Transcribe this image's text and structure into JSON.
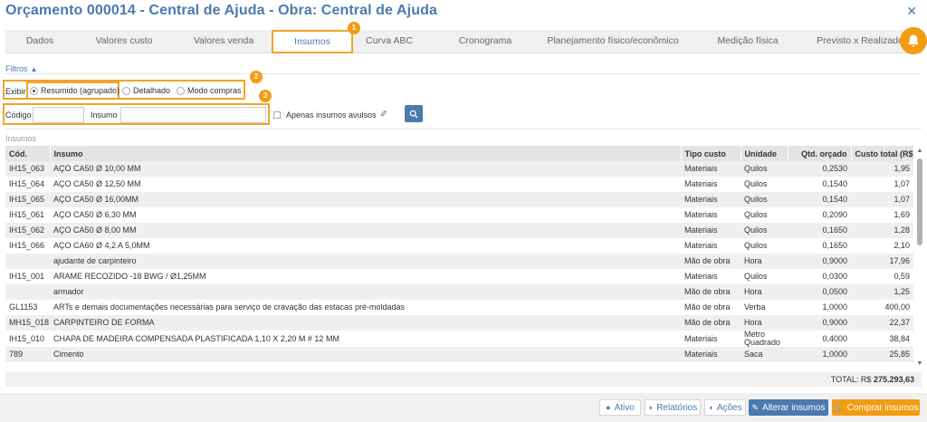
{
  "header": {
    "title": "Orçamento 000014 - Central de Ajuda - Obra: Central de Ajuda"
  },
  "tabs": [
    {
      "label": "Dados",
      "active": false
    },
    {
      "label": "Valores custo",
      "active": false
    },
    {
      "label": "Valores venda",
      "active": false
    },
    {
      "label": "Insumos",
      "active": true
    },
    {
      "label": "Curva ABC",
      "active": false
    },
    {
      "label": "Cronograma",
      "active": false
    },
    {
      "label": "Planejamento físico/econômico",
      "active": false
    },
    {
      "label": "Medição física",
      "active": false
    },
    {
      "label": "Previsto x Realizado",
      "active": false
    }
  ],
  "badges": [
    "1",
    "2",
    "3"
  ],
  "filters": {
    "toggle_label": "Filtros",
    "exibir_label": "Exibir",
    "options": [
      {
        "label": "Resumido (agrupado)",
        "selected": true
      },
      {
        "label": "Detalhado",
        "selected": false
      },
      {
        "label": "Modo compras",
        "selected": false
      }
    ],
    "codigo_label": "Código",
    "codigo_value": "",
    "insumo_label": "Insumo",
    "insumo_value": "",
    "avulsos_label": "Apenas insumos avulsos"
  },
  "section_label": "Insumos",
  "table": {
    "columns": [
      "Cód.",
      "Insumo",
      "Tipo custo",
      "Unidade",
      "Qtd. orçado",
      "Custo total (R$)"
    ],
    "rows": [
      [
        "IH15_063",
        "AÇO CA50 Ø 10,00 MM",
        "Materiais",
        "Quilos",
        "0,2530",
        "1,95"
      ],
      [
        "IH15_064",
        "AÇO CA50 Ø 12,50 MM",
        "Materiais",
        "Quilos",
        "0,1540",
        "1,07"
      ],
      [
        "IH15_065",
        "AÇO CA50 Ø 16,00MM",
        "Materiais",
        "Quilos",
        "0,1540",
        "1,07"
      ],
      [
        "IH15_061",
        "AÇO CA50 Ø 6,30 MM",
        "Materiais",
        "Quilos",
        "0,2090",
        "1,69"
      ],
      [
        "IH15_062",
        "AÇO CA50 Ø 8,00 MM",
        "Materiais",
        "Quilos",
        "0,1650",
        "1,28"
      ],
      [
        "IH15_066",
        "AÇO CA60 Ø 4,2 A 5,0MM",
        "Materiais",
        "Quilos",
        "0,1650",
        "2,10"
      ],
      [
        "",
        "ajudante de carpinteiro",
        "Mão de obra",
        "Hora",
        "0,9000",
        "17,96"
      ],
      [
        "IH15_001",
        "ARAME RECOZIDO -18 BWG / Ø1,25MM",
        "Materiais",
        "Quilos",
        "0,0300",
        "0,59"
      ],
      [
        "",
        "armador",
        "Mão de obra",
        "Hora",
        "0,0500",
        "1,25"
      ],
      [
        "GL1153",
        "ARTs e demais documentações necessárias para serviço de cravação das estacas pré-moldadas",
        "Mão de obra",
        "Verba",
        "1,0000",
        "400,00"
      ],
      [
        "MH15_018",
        "CARPINTEIRO DE FORMA",
        "Mão de obra",
        "Hora",
        "0,9000",
        "22,37"
      ],
      [
        "IH15_010",
        "CHAPA DE MADEIRA COMPENSADA PLASTIFICADA 1,10 X 2,20 M # 12 MM",
        "Materiais",
        "Metro Quadrado",
        "0,4000",
        "38,84"
      ],
      [
        "789",
        "Cimento",
        "Materiais",
        "Saca",
        "1,0000",
        "25,85"
      ]
    ]
  },
  "total": {
    "label": "TOTAL: R$",
    "value": "275.293,63"
  },
  "footer": {
    "ativo": "Ativo",
    "relatorios": "Relatórios",
    "acoes": "Ações",
    "alterar": "Alterar insumos",
    "comprar": "Comprar insumos"
  },
  "colors": {
    "accent": "#4a7ab0",
    "highlight": "#f0a52b",
    "orange": "#f39c12"
  }
}
